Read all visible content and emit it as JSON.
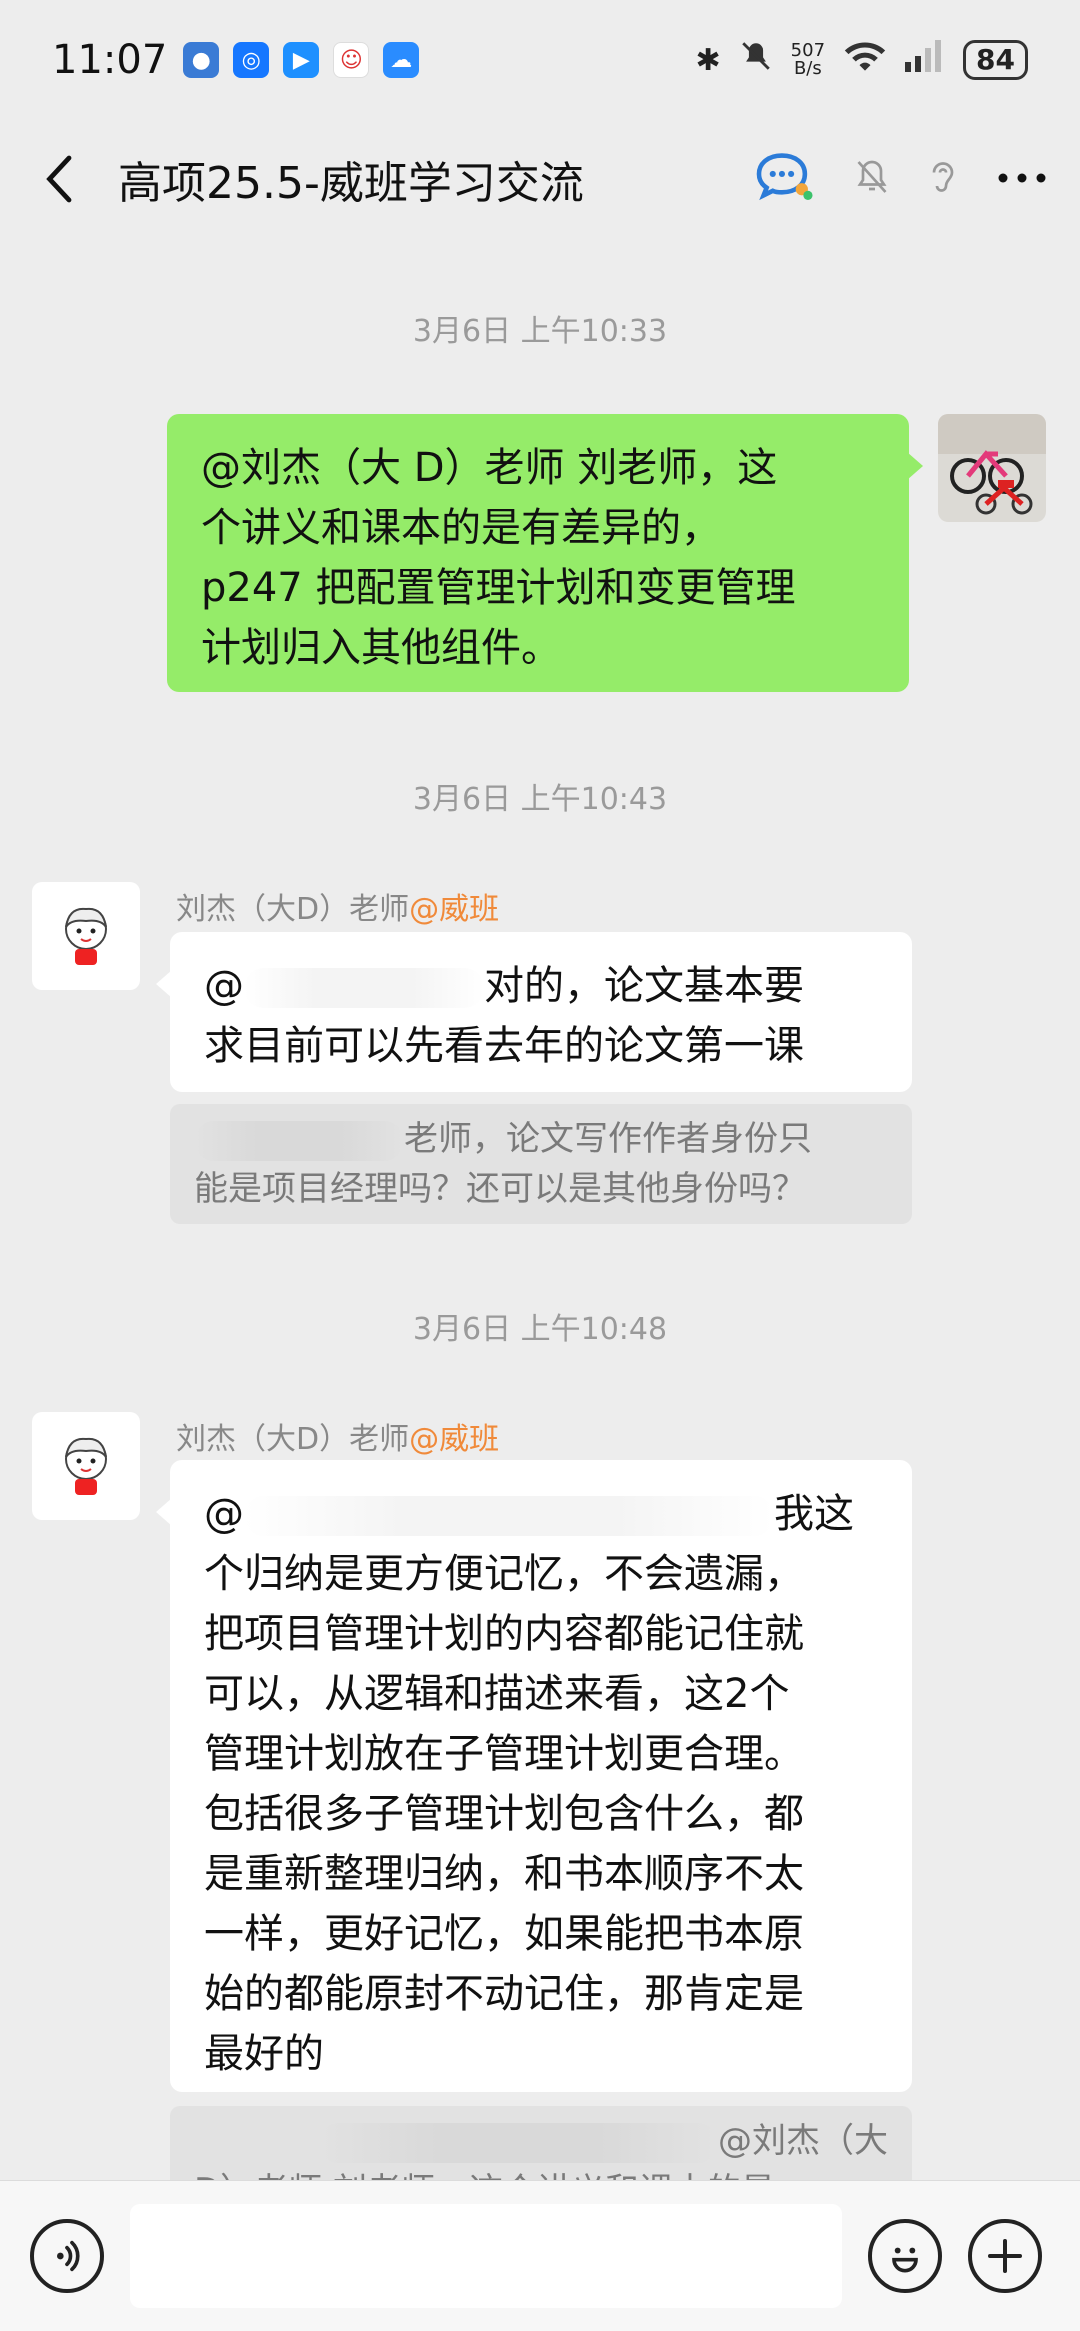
{
  "status_bar": {
    "time": "11:07",
    "net_speed_value": "507",
    "net_speed_unit": "B/s",
    "battery": "84"
  },
  "header": {
    "title": "高项25.5-威班学习交流"
  },
  "messages": [
    {
      "timestamp": "3月6日 上午10:33",
      "line1": "@刘杰（大 D）老师  刘老师，这",
      "line2": "个讲义和课本的是有差异的，",
      "line3": "p247 把配置管理计划和变更管理",
      "line4": "计划归入其他组件。"
    },
    {
      "timestamp": "3月6日 上午10:43",
      "sender_name": "刘杰（大D）老师",
      "sender_tag": "@威班",
      "line1_prefix": "@",
      "line1_suffix": "对的，论文基本要",
      "line2": "求目前可以先看去年的论文第一课",
      "quote_line1": "老师，论文写作作者身份只",
      "quote_line2": "能是项目经理吗？还可以是其他身份吗？"
    },
    {
      "timestamp": "3月6日 上午10:48",
      "sender_name": "刘杰（大D）老师",
      "sender_tag": "@威班",
      "line1_prefix": "@",
      "line1_suffix": "我这",
      "lines": [
        "个归纳是更方便记忆，不会遗漏，",
        "把项目管理计划的内容都能记住就",
        "可以，从逻辑和描述来看，这2个",
        "管理计划放在子管理计划更合理。",
        "包括很多子管理计划包含什么，都",
        "是重新整理归纳，和书本顺序不太",
        "一样，更好记忆，如果能把书本原",
        "始的都能原封不动记住，那肯定是",
        "最好的"
      ],
      "quote_line1": "@刘杰（大",
      "quote_line2": "D）老师 刘老师，这个讲义和课本的是"
    }
  ],
  "icons": {
    "back": "chevron-left-icon",
    "chat_search": "chat-bubble-search-icon",
    "mute": "bell-off-icon",
    "earpiece": "ear-icon",
    "more": "more-dots-icon",
    "voice": "voice-icon",
    "emoji": "emoji-icon",
    "add": "plus-circle-icon"
  }
}
